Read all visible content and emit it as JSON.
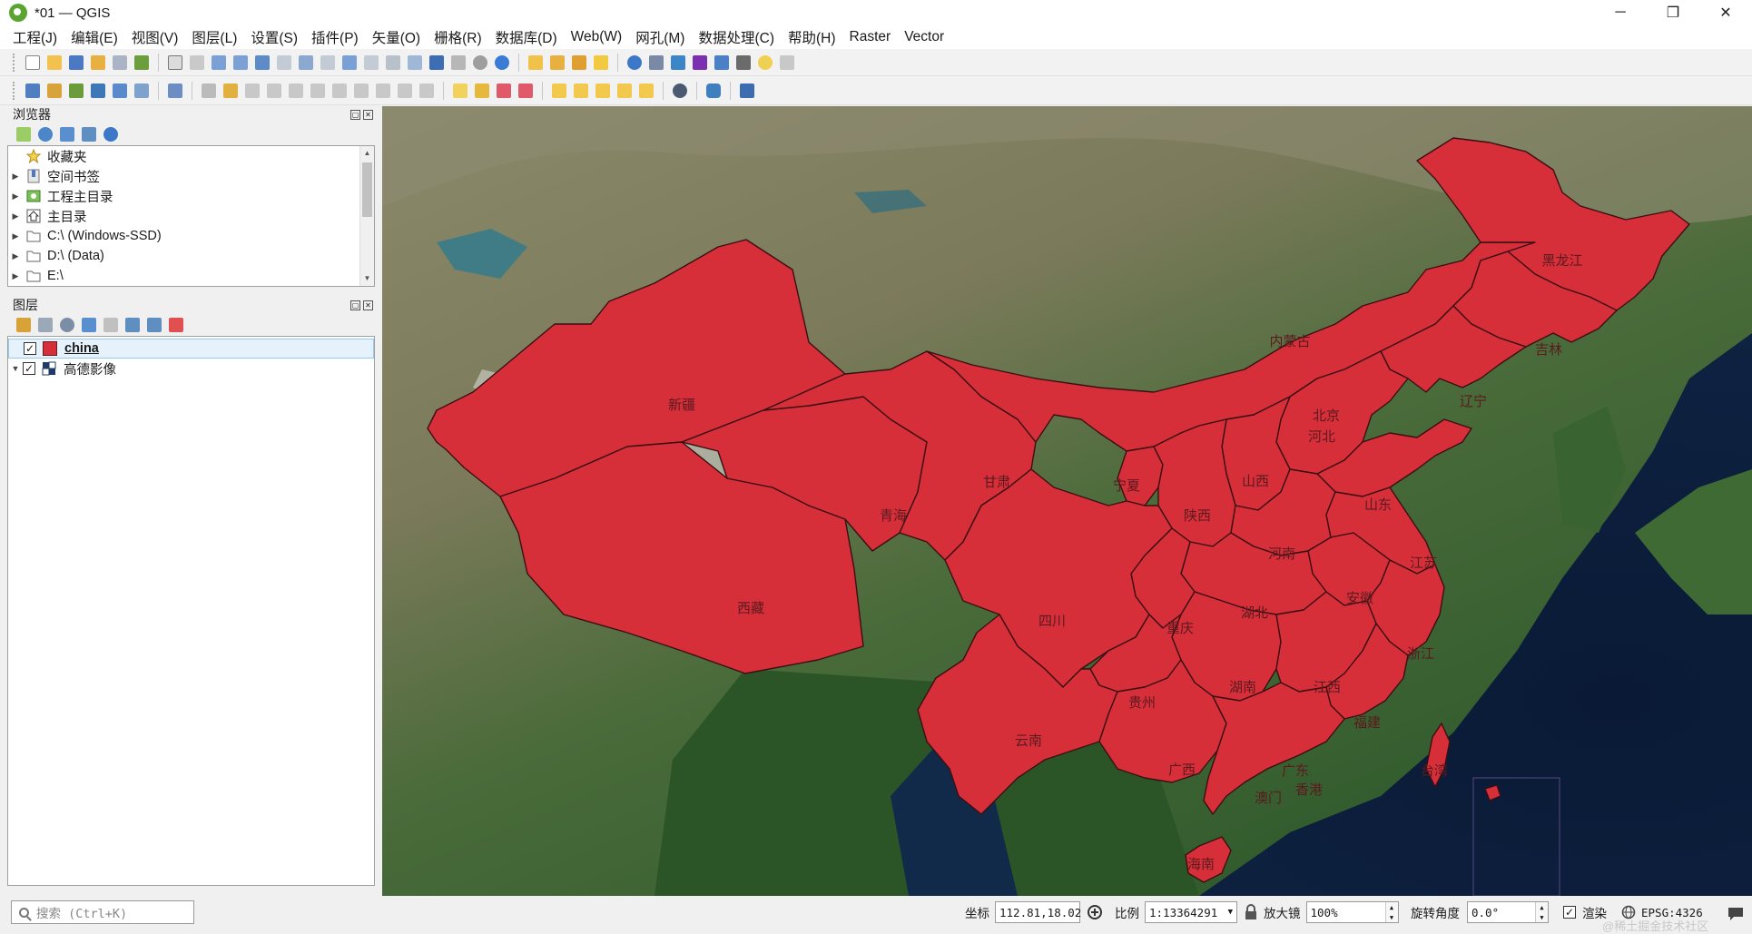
{
  "window": {
    "title": "*01 — QGIS",
    "controls": {
      "minimize": "─",
      "restore": "❐",
      "close": "✕"
    }
  },
  "menubar": [
    "工程(J)",
    "编辑(E)",
    "视图(V)",
    "图层(L)",
    "设置(S)",
    "插件(P)",
    "矢量(O)",
    "栅格(R)",
    "数据库(D)",
    "Web(W)",
    "网孔(M)",
    "数据处理(C)",
    "帮助(H)",
    "Raster",
    "Vector"
  ],
  "browser": {
    "title": "浏览器",
    "items": [
      {
        "label": "收藏夹",
        "icon": "star-icon"
      },
      {
        "label": "空间书签",
        "icon": "bookmark-icon"
      },
      {
        "label": "工程主目录",
        "icon": "project-home-icon"
      },
      {
        "label": "主目录",
        "icon": "home-icon"
      },
      {
        "label": "C:\\ (Windows-SSD)",
        "icon": "folder-icon"
      },
      {
        "label": "D:\\ (Data)",
        "icon": "folder-icon"
      },
      {
        "label": "E:\\",
        "icon": "folder-icon"
      }
    ]
  },
  "layers": {
    "title": "图层",
    "items": [
      {
        "label": "china",
        "checked": true,
        "selected": true,
        "color": "#d62f3a"
      },
      {
        "label": "高德影像",
        "checked": true,
        "selected": false
      }
    ]
  },
  "map": {
    "labels": {
      "xinjiang": "新疆",
      "xizang": "西藏",
      "qinghai": "青海",
      "gansu": "甘肃",
      "neimenggu": "内蒙古",
      "heilongjiang": "黑龙江",
      "jilin": "吉林",
      "liaoning": "辽宁",
      "beijing": "北京",
      "hebei": "河北",
      "shanxi": "山西",
      "shandong": "山东",
      "ningxia": "宁夏",
      "shaanxi": "陕西",
      "henan": "河南",
      "jiangsu": "江苏",
      "anhui": "安徽",
      "hubei": "湖北",
      "chongqing": "重庆",
      "sichuan": "四川",
      "zhejiang": "浙江",
      "hunan": "湖南",
      "jiangxi": "江西",
      "guizhou": "贵州",
      "fujian": "福建",
      "yunnan": "云南",
      "guangxi": "广西",
      "guangdong": "广东",
      "xianggang": "香港",
      "aomen": "澳门",
      "taiwan": "台湾",
      "hainan": "海南"
    }
  },
  "statusbar": {
    "search_placeholder": "搜索 (Ctrl+K)",
    "coord_label": "坐标",
    "coord_value": "112.81,18.02",
    "scale_label": "比例",
    "scale_value": "1:13364291",
    "magnifier_label": "放大镜",
    "magnifier_value": "100%",
    "rotation_label": "旋转角度",
    "rotation_value": "0.0°",
    "render_label": "渲染",
    "render_checked": true,
    "crs_value": "EPSG:4326"
  },
  "watermark": "@稀土掘金技术社区",
  "colors": {
    "province_fill": "#d62f3a",
    "province_stroke": "#3b0f12",
    "ocean": "#0b1e3a"
  }
}
